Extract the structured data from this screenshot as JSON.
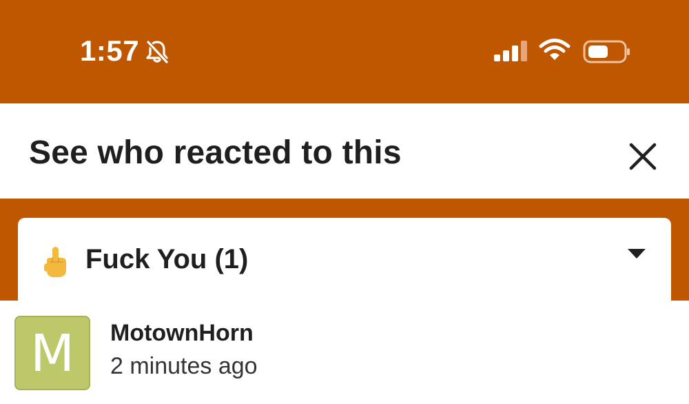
{
  "status_bar": {
    "time": "1:57",
    "silent_icon": "bell-slash-icon",
    "signal_icon": "cellular-signal-icon",
    "wifi_icon": "wifi-icon",
    "battery_icon": "battery-icon"
  },
  "sheet": {
    "title": "See who reacted to this",
    "close_icon": "close-icon"
  },
  "reaction_filter": {
    "emoji": "middle-finger-emoji",
    "label": "Fuck You (1)",
    "dropdown_icon": "chevron-down-icon"
  },
  "reactors": [
    {
      "avatar_letter": "M",
      "name": "MotownHorn",
      "time": "2 minutes ago"
    }
  ],
  "colors": {
    "brand_orange": "#bf5600",
    "avatar_green": "#bdc86a"
  }
}
